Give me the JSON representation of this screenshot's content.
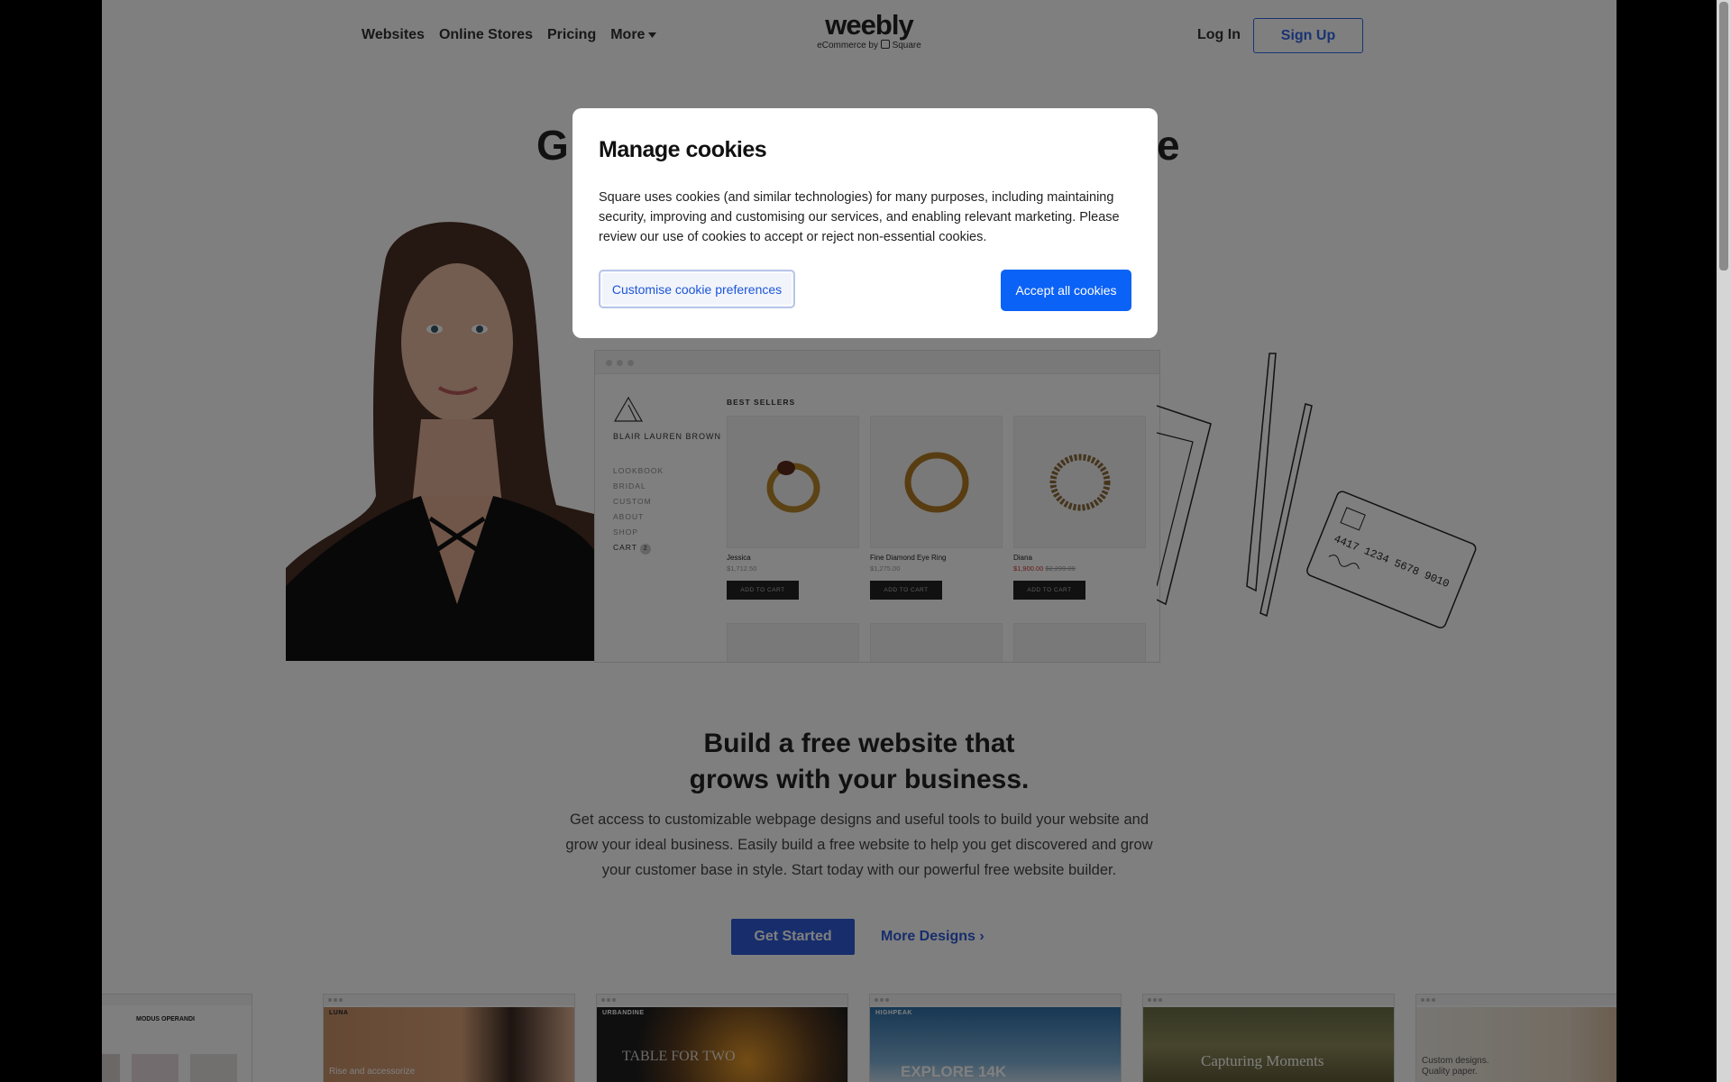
{
  "nav": {
    "items": [
      "Websites",
      "Online Stores",
      "Pricing",
      "More"
    ],
    "logo": "weebly",
    "logo_sub_prefix": "eCommerce by",
    "logo_sub_brand": "Square",
    "login": "Log In",
    "signup": "Sign Up"
  },
  "hero": {
    "title_visible_left": "G",
    "title_visible_right": "e",
    "store": {
      "name": "BLAIR LAUREN BROWN",
      "menu": [
        "LOOKBOOK",
        "BRIDAL",
        "CUSTOM",
        "ABOUT",
        "SHOP",
        "CART"
      ],
      "cart_count": "2",
      "section_heading": "BEST SELLERS",
      "products": [
        {
          "name": "Jessica",
          "price": "$1,712.50",
          "sale": "",
          "orig": "",
          "button": "ADD TO CART"
        },
        {
          "name": "Fine Diamond Eye Ring",
          "price": "$1,275.00",
          "sale": "",
          "orig": "",
          "button": "ADD TO CART"
        },
        {
          "name": "Diana",
          "price": "",
          "sale": "$1,900.00",
          "orig": "$2,299.00",
          "button": "ADD TO CART"
        }
      ]
    },
    "card_number": "4417 1234 5678 9010"
  },
  "section": {
    "title_line1": "Build a free website that",
    "title_line2": "grows with your business.",
    "text": "Get access to customizable webpage designs and useful tools to build your website and grow your ideal business. Easily build a free website to help you get discovered and grow your customer base in style. Start today with our powerful free website builder.",
    "cta": "Get Started",
    "more": "More Designs ›"
  },
  "thumbnails": [
    {
      "brand": "MODUS OPERANDI",
      "caption": ""
    },
    {
      "brand": "LUNA",
      "caption": "Rise and accessorize"
    },
    {
      "brand": "URBANDINE",
      "caption": "TABLE FOR TWO"
    },
    {
      "brand": "HIGHPEAK",
      "caption": "EXPLORE 14K"
    },
    {
      "brand": "",
      "caption": "Capturing Moments"
    },
    {
      "brand": "",
      "caption": "Custom designs. Quality paper."
    }
  ],
  "modal": {
    "title": "Manage cookies",
    "text": "Square uses cookies (and similar technologies) for many purposes, including maintaining security, improving and customising our services, and enabling relevant marketing. Please review our use of cookies to accept or reject non-essential cookies.",
    "customise": "Customise cookie preferences",
    "accept": "Accept all cookies"
  }
}
